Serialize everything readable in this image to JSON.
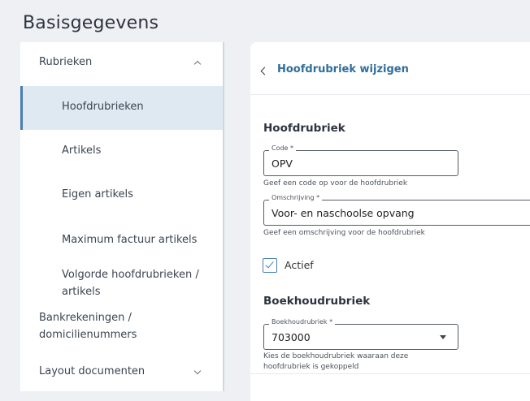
{
  "page": {
    "title": "Basisgegevens"
  },
  "sidebar": {
    "items": [
      {
        "label": "Rubrieken"
      },
      {
        "label": "Hoofdrubrieken"
      },
      {
        "label": "Artikels"
      },
      {
        "label": "Eigen artikels"
      },
      {
        "label": "Maximum factuur artikels"
      },
      {
        "label_line1": "Volgorde hoofdrubrieken /",
        "label_line2": "artikels"
      },
      {
        "label_line1": "Bankrekeningen /",
        "label_line2": "domicilienummers"
      },
      {
        "label": "Layout documenten"
      }
    ],
    "active_index": 1
  },
  "main": {
    "header_title": "Hoofdrubriek wijzigen",
    "section_hoofdrubriek": "Hoofdrubriek",
    "code": {
      "label": "Code *",
      "value": "OPV",
      "hint": "Geef een code op voor de hoofdrubriek"
    },
    "omschrijving": {
      "label": "Omschrijving *",
      "value": "Voor- en naschoolse opvang",
      "hint": "Geef een omschrijving voor de hoofdrubriek"
    },
    "actief": {
      "label": "Actief",
      "checked": true
    },
    "section_boekhoud": "Boekhoudrubriek",
    "boekhoudrubriek": {
      "label": "Boekhoudrubriek *",
      "value": "703000",
      "hint_line1": "Kies de boekhoudrubriek waaraan deze",
      "hint_line2": "hoofdrubriek is gekoppeld"
    }
  },
  "colors": {
    "accent": "#4a7fb0",
    "active_bg": "#dfe9f2",
    "link": "#2f6d9c"
  }
}
